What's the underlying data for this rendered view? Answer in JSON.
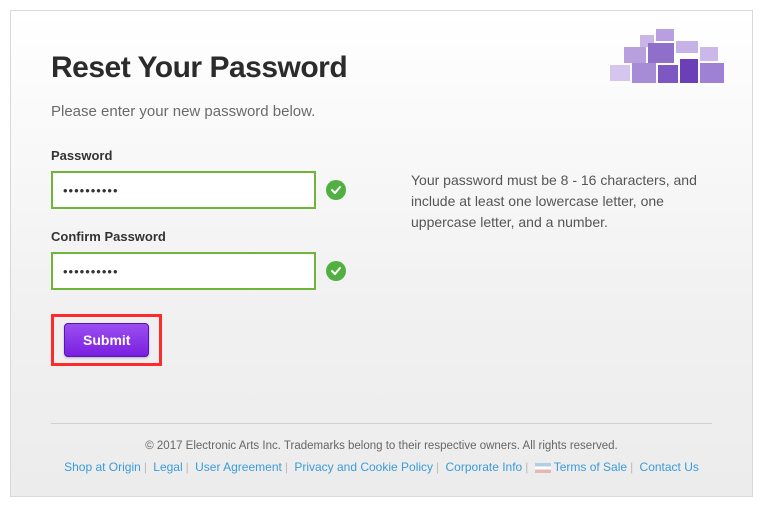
{
  "heading": "Reset Your Password",
  "subtitle": "Please enter your new password below.",
  "fields": {
    "password_label": "Password",
    "password_value": "••••••••••",
    "confirm_label": "Confirm Password",
    "confirm_value": "••••••••••"
  },
  "requirements": "Your password must be 8 - 16 characters, and include at least one lowercase letter, one uppercase letter, and a number.",
  "submit_label": "Submit",
  "footer": {
    "copyright": "© 2017 Electronic Arts Inc. Trademarks belong to their respective owners. All rights reserved.",
    "links": [
      "Shop at Origin",
      "Legal",
      "User Agreement",
      "Privacy and Cookie Policy",
      "Corporate Info",
      "Terms of Sale",
      "Contact Us"
    ]
  },
  "colors": {
    "accent_purple": "#7a1fe0",
    "valid_green": "#52b043",
    "highlight_red": "#ff2a2a",
    "link_blue": "#3a9bd9"
  }
}
